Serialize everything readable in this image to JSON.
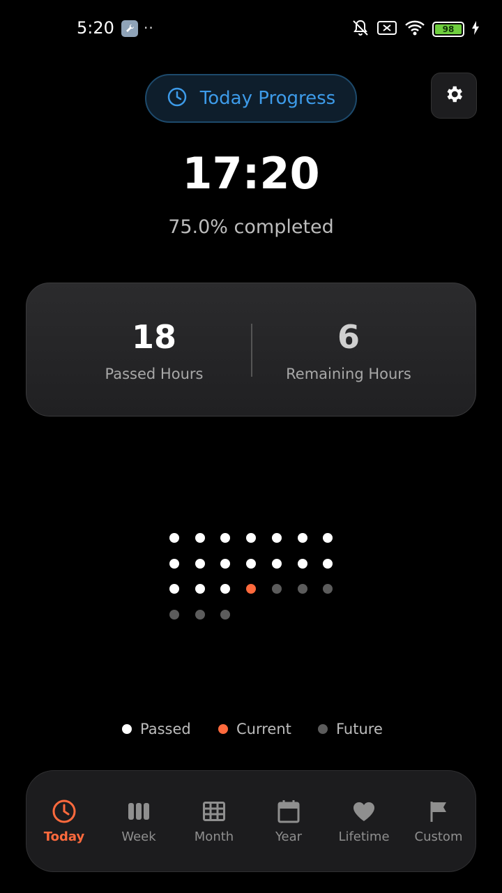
{
  "status_bar": {
    "time": "5:20",
    "dots": "··",
    "battery": "98",
    "icons": [
      "wrench-icon",
      "bell-off-icon",
      "sim-x-icon",
      "wifi-icon",
      "battery-icon",
      "charging-icon"
    ]
  },
  "header": {
    "pill_label": "Today Progress",
    "pill_icon": "clock-icon",
    "settings_icon": "gear-icon"
  },
  "main": {
    "current_time": "17:20",
    "completed_text": "75.0% completed"
  },
  "stats": {
    "passed_value": "18",
    "passed_label": "Passed Hours",
    "remaining_value": "6",
    "remaining_label": "Remaining Hours"
  },
  "hours_grid": {
    "total": 24,
    "passed": 17,
    "current_index": 17,
    "columns": 7
  },
  "legend": {
    "passed": "Passed",
    "current": "Current",
    "future": "Future"
  },
  "nav": {
    "today": "Today",
    "week": "Week",
    "month": "Month",
    "year": "Year",
    "lifetime": "Lifetime",
    "custom": "Custom"
  },
  "colors": {
    "accent": "#ff6a3d",
    "pill_blue": "#3d9be9",
    "passed": "#ffffff",
    "future": "#5c5c5c"
  }
}
